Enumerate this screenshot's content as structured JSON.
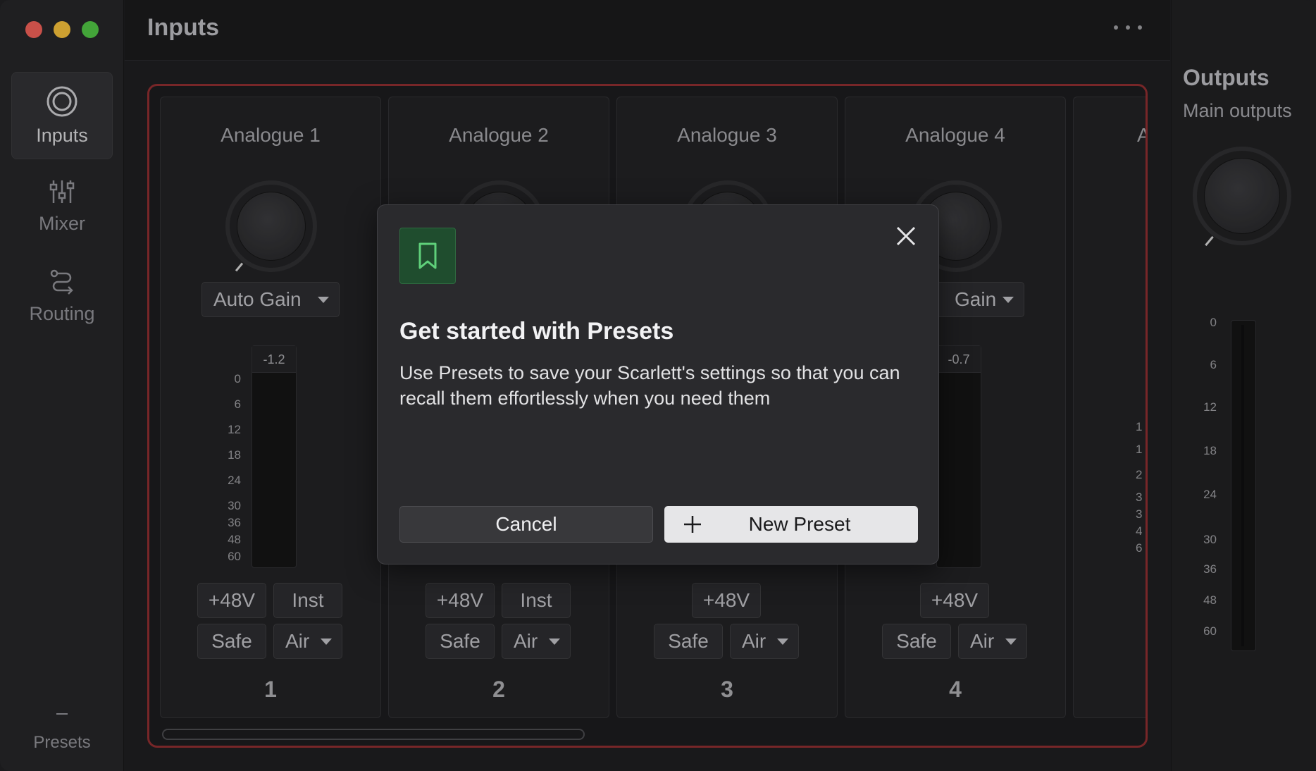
{
  "sidebar": {
    "items": [
      {
        "label": "Inputs",
        "icon": "inputs-icon",
        "active": true
      },
      {
        "label": "Mixer",
        "icon": "mixer-icon",
        "active": false
      },
      {
        "label": "Routing",
        "icon": "routing-icon",
        "active": false
      }
    ],
    "presets_label": "Presets"
  },
  "header": {
    "title": "Inputs"
  },
  "channels": [
    {
      "title": "Analogue 1",
      "gain_mode": "Auto Gain",
      "peak": "-1.2",
      "buttons": [
        "+48V",
        "Inst"
      ],
      "safe": "Safe",
      "air": "Air",
      "number": "1"
    },
    {
      "title": "Analogue 2",
      "gain_mode": "",
      "peak": "",
      "buttons": [
        "+48V",
        "Inst"
      ],
      "safe": "Safe",
      "air": "Air",
      "number": "2"
    },
    {
      "title": "Analogue 3",
      "gain_mode": "",
      "peak": "",
      "buttons": [
        "+48V"
      ],
      "safe": "Safe",
      "air": "Air",
      "number": "3"
    },
    {
      "title": "Analogue 4",
      "gain_mode": "Gain",
      "peak": "-0.7",
      "buttons": [
        "+48V"
      ],
      "safe": "Safe",
      "air": "Air",
      "number": "4"
    },
    {
      "title": "A",
      "gain_mode": "",
      "peak": "",
      "buttons": [],
      "safe": "",
      "air": "",
      "number": ""
    }
  ],
  "meter_scale": [
    "0",
    "6",
    "12",
    "18",
    "24",
    "30",
    "36",
    "48",
    "60"
  ],
  "partial_scale": [
    "1",
    "1",
    "2",
    "3",
    "3",
    "4",
    "6"
  ],
  "outputs": {
    "title": "Outputs",
    "subtitle": "Main outputs",
    "scale": [
      "0",
      "6",
      "12",
      "18",
      "24",
      "30",
      "36",
      "48",
      "60"
    ]
  },
  "modal": {
    "title": "Get started with Presets",
    "body": "Use Presets to save your Scarlett's settings so that you can recall them effortlessly when you need them",
    "cancel_label": "Cancel",
    "new_label": "New Preset",
    "icon": "bookmark-icon",
    "accent": "#1f4d2e"
  },
  "colors": {
    "frame_border": "#8c2d2f",
    "close_red": "#ec5e56",
    "minimize_yellow": "#f1bc3a",
    "zoom_green": "#4fc143"
  }
}
